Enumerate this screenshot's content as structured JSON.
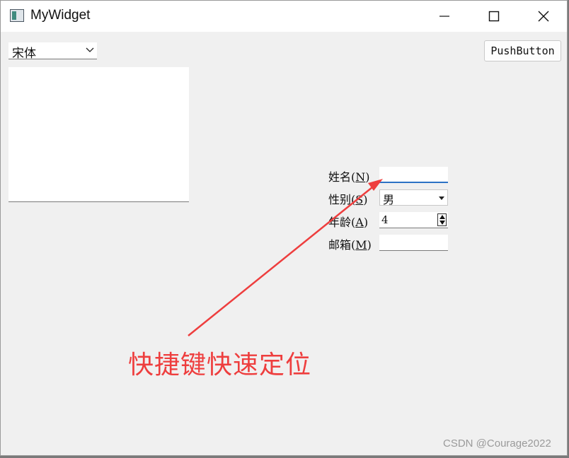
{
  "window": {
    "title": "MyWidget",
    "icon": "app-window-icon",
    "controls": [
      "minimize-icon",
      "maximize-icon",
      "close-icon"
    ]
  },
  "toolbar": {
    "font_combo_value": "宋体",
    "push_button_label": "PushButton"
  },
  "form": {
    "name": {
      "label_text": "姓名(",
      "mnemonic": "N",
      "label_close": ")",
      "value": ""
    },
    "gender": {
      "label_text": "性别(",
      "mnemonic": "S",
      "label_close": ")",
      "value": "男"
    },
    "age": {
      "label_text": "年龄(",
      "mnemonic": "A",
      "label_close": ")",
      "value": "4"
    },
    "email": {
      "label_text": "邮箱(",
      "mnemonic": "M",
      "label_close": ")",
      "value": ""
    }
  },
  "annotation": {
    "text": "快捷键快速定位",
    "color": "#ee3e3e"
  },
  "watermark": "CSDN @Courage2022"
}
